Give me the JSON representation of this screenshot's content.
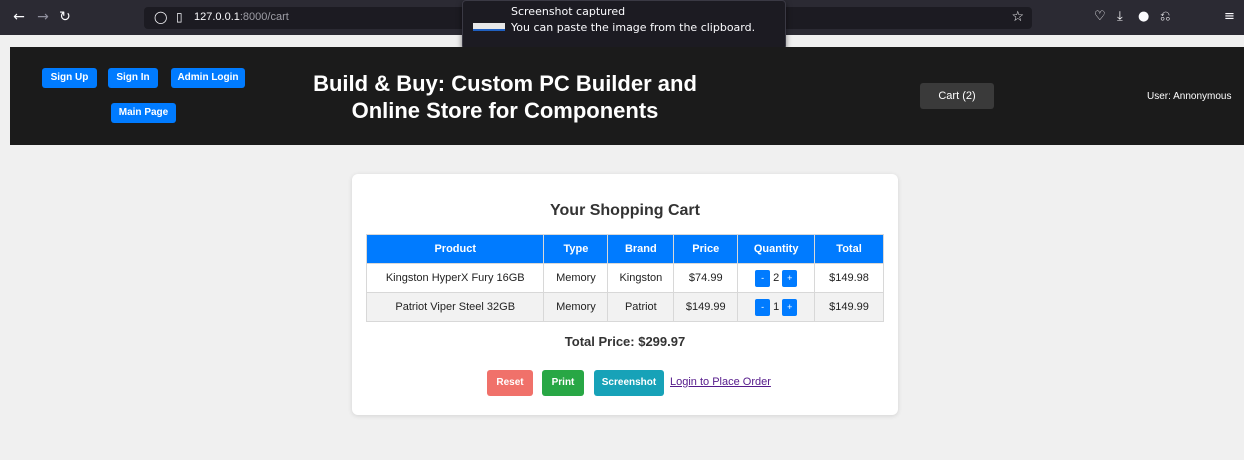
{
  "browser": {
    "url_host": "127.0.0.1",
    "url_path": ":8000/cart",
    "notification_title": "Screenshot captured",
    "notification_body": "You can paste the image from the clipboard."
  },
  "header": {
    "signup_label": "Sign Up",
    "signin_label": "Sign In",
    "admin_login_label": "Admin Login",
    "main_page_label": "Main Page",
    "title": "Build & Buy: Custom PC Builder and Online Store for Components",
    "cart_label": "Cart (2)",
    "user_label": "User: Annonymous"
  },
  "cart": {
    "title": "Your Shopping Cart",
    "columns": [
      "Product",
      "Type",
      "Brand",
      "Price",
      "Quantity",
      "Total"
    ],
    "rows": [
      {
        "product": "Kingston HyperX Fury 16GB",
        "type": "Memory",
        "brand": "Kingston",
        "price": "$74.99",
        "quantity": "2",
        "total": "$149.98"
      },
      {
        "product": "Patriot Viper Steel 32GB",
        "type": "Memory",
        "brand": "Patriot",
        "price": "$149.99",
        "quantity": "1",
        "total": "$149.99"
      }
    ],
    "decrement_label": "-",
    "increment_label": "+",
    "total_price": "Total Price: $299.97",
    "reset_label": "Reset",
    "print_label": "Print",
    "screenshot_label": "Screenshot",
    "login_link": "Login to Place Order"
  },
  "colors": {
    "primary": "#007bff",
    "header_bg": "#1b1b1b",
    "reset": "#f0716a",
    "print": "#28a745",
    "screenshot": "#17a2b8"
  }
}
